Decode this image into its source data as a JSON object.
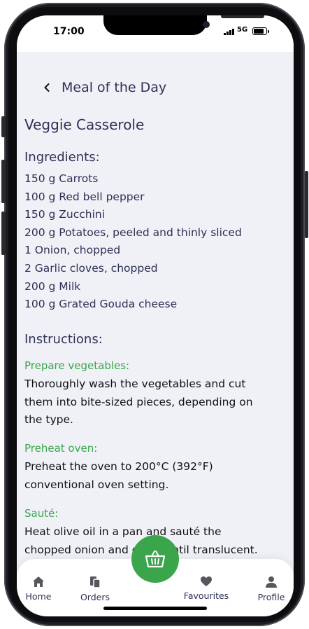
{
  "status_bar": {
    "time": "17:00",
    "network": "5G"
  },
  "header": {
    "back_icon": "chevron-left-icon",
    "title": "Meal of the Day"
  },
  "recipe": {
    "name": "Veggie Casserole",
    "ingredients_heading": "Ingredients:",
    "ingredients": [
      "150 g Carrots",
      "100 g Red bell pepper",
      "150 g Zucchini",
      "200 g Potatoes, peeled and thinly sliced",
      "1 Onion, chopped",
      "2 Garlic cloves, chopped",
      "200 g Milk",
      "100 g Grated Gouda cheese"
    ],
    "instructions_heading": "Instructions:",
    "steps": [
      {
        "title": "Prepare vegetables:",
        "text": "Thoroughly wash the vegetables and cut them into bite-sized pieces, depending on the type."
      },
      {
        "title": "Preheat oven:",
        "text": "Preheat the oven to 200°C (392°F) conventional oven setting."
      },
      {
        "title": "Sauté:",
        "text": "Heat olive oil in a pan and sauté the chopped onion and garlic until translucent."
      }
    ]
  },
  "nav": {
    "items": [
      {
        "label": "Home",
        "icon": "home-icon"
      },
      {
        "label": "Orders",
        "icon": "orders-icon"
      },
      {
        "label": "Favourites",
        "icon": "heart-icon"
      },
      {
        "label": "Profile",
        "icon": "profile-icon"
      }
    ],
    "fab_icon": "basket-icon"
  },
  "colors": {
    "accent": "#3aa54a",
    "text_primary": "#2d3154",
    "background": "#f0f1f7"
  }
}
